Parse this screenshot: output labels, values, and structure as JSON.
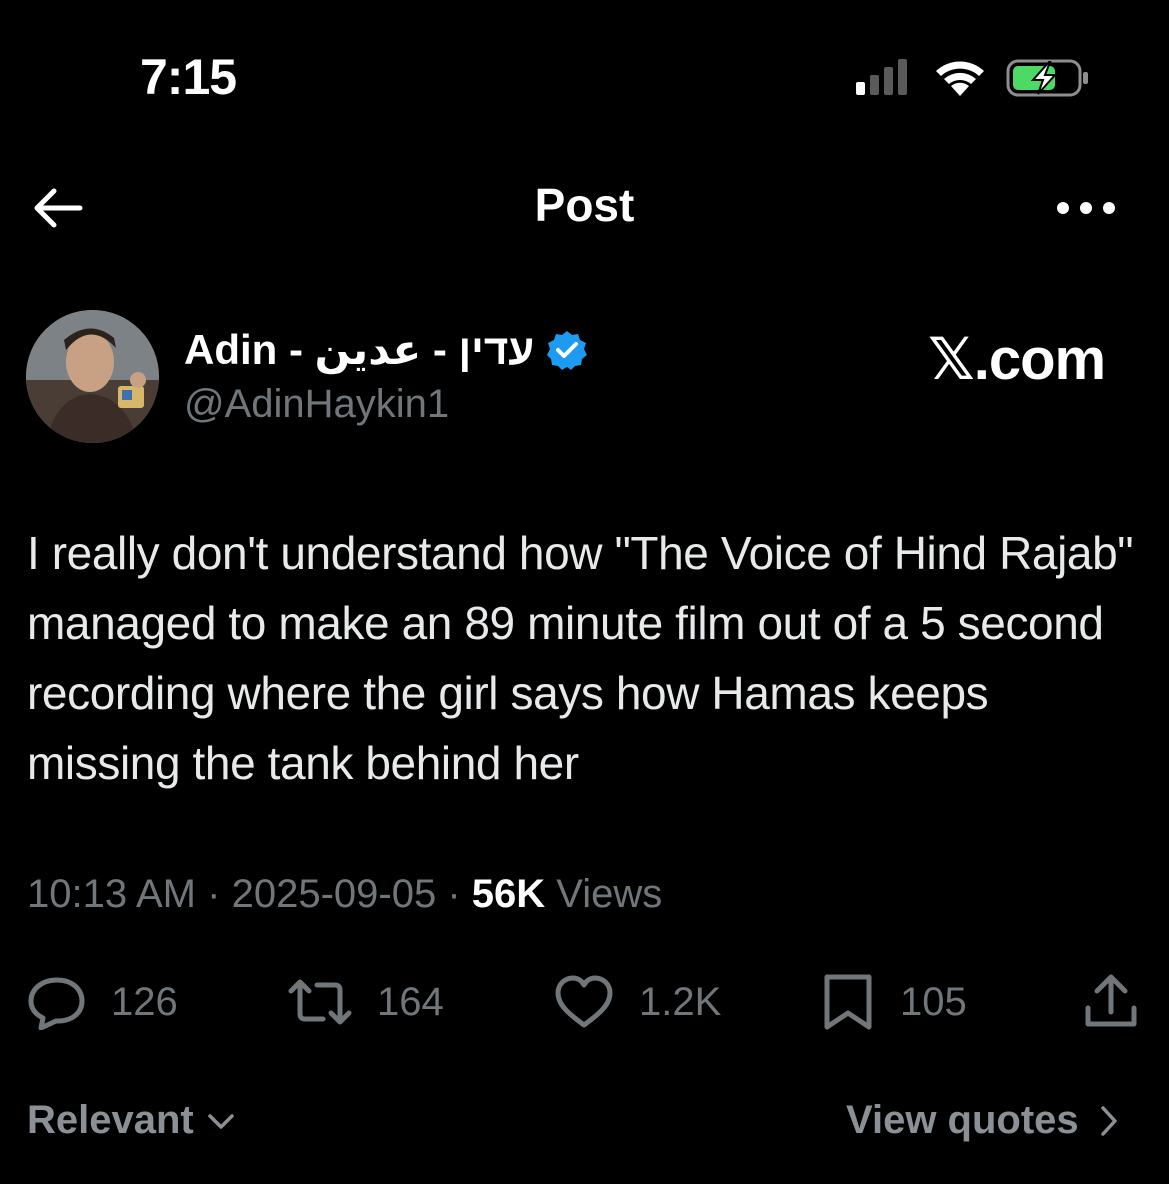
{
  "status_bar": {
    "time": "7:15",
    "icons": [
      "cellular-signal-icon",
      "wifi-icon",
      "battery-charging-icon"
    ],
    "battery_color": "#4cd964"
  },
  "nav": {
    "back_icon": "arrow-left-icon",
    "title": "Post",
    "more_icon": "more-horizontal-icon"
  },
  "author": {
    "display_name": "Adin - עדין - عدين",
    "verified": true,
    "verified_color": "#1d9bf0",
    "handle": "@AdinHaykin1"
  },
  "watermark": "𝕏.com",
  "tweet": {
    "text": "I really don't understand how \"The Voice of Hind Rajab\" managed to make an 89 minute film out of a 5 second recording where the girl says how Hamas keeps missing the tank behind her",
    "time": "10:13 AM",
    "separator": "·",
    "date": "2025-09-05",
    "views_count": "56K",
    "views_label": "Views"
  },
  "actions": [
    {
      "icon": "reply-icon",
      "count": "126"
    },
    {
      "icon": "retweet-icon",
      "count": "164"
    },
    {
      "icon": "like-icon",
      "count": "1.2K"
    },
    {
      "icon": "bookmark-icon",
      "count": "105"
    },
    {
      "icon": "share-icon",
      "count": ""
    }
  ],
  "footer": {
    "sort_label": "Relevant",
    "quotes_label": "View quotes"
  },
  "colors": {
    "background": "#000000",
    "text": "#e7e9ea",
    "secondary": "#71767b"
  }
}
